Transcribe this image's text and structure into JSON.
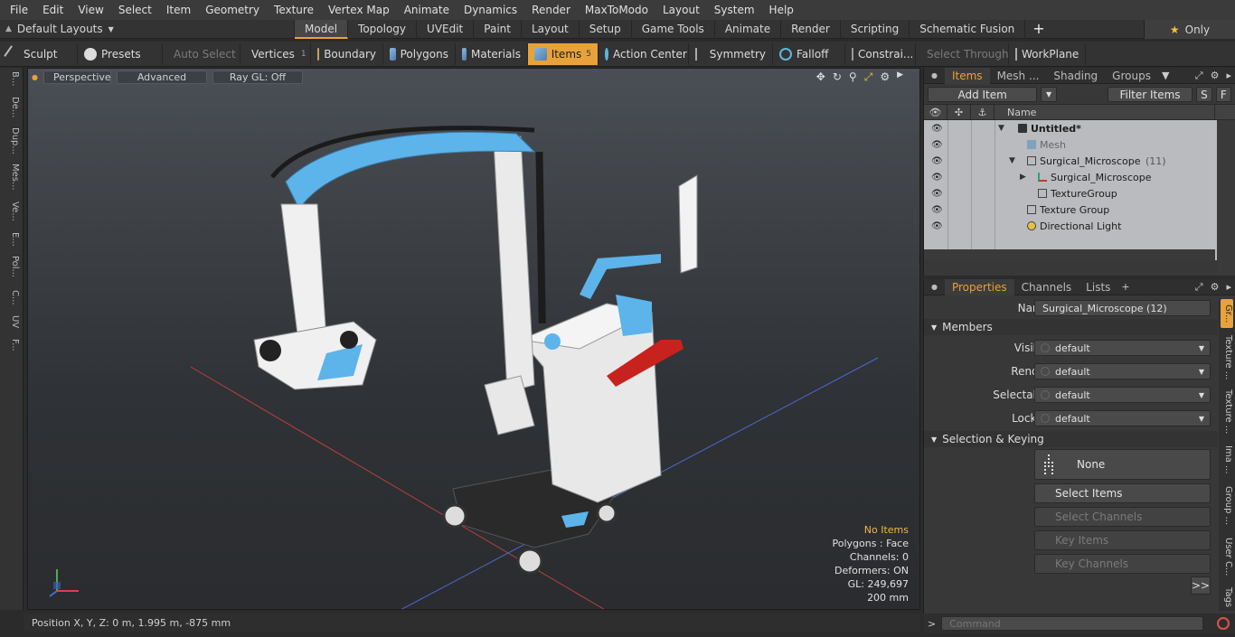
{
  "menu": [
    "File",
    "Edit",
    "View",
    "Select",
    "Item",
    "Geometry",
    "Texture",
    "Vertex Map",
    "Animate",
    "Dynamics",
    "Render",
    "MaxToModo",
    "Layout",
    "System",
    "Help"
  ],
  "layout_bar": {
    "layout_select": "Default Layouts",
    "tabs": [
      "Model",
      "Topology",
      "UVEdit",
      "Paint",
      "Layout",
      "Setup",
      "Game Tools",
      "Animate",
      "Render",
      "Scripting",
      "Schematic Fusion"
    ],
    "active_tab": "Model",
    "only_label": "Only"
  },
  "toolbar": {
    "sculpt": "Sculpt",
    "presets": "Presets",
    "auto_select": "Auto Select",
    "vertices": "Vertices",
    "vertices_count": "1",
    "boundary": "Boundary",
    "polygons": "Polygons",
    "materials": "Materials",
    "items": "Items",
    "items_count": "5",
    "action_center": "Action Center",
    "symmetry": "Symmetry",
    "falloff": "Falloff",
    "constraints": "Constrai...",
    "select_through": "Select Through",
    "workplane": "WorkPlane"
  },
  "left_tabs": [
    "B...",
    "De...",
    "Dup...",
    "Mes...",
    "Ve...",
    "E...",
    "Pol...",
    "C...",
    "UV",
    "F..."
  ],
  "viewport": {
    "view_mode": "Perspective",
    "shading": "Advanced",
    "raygl": "Ray GL: Off",
    "info": {
      "selection": "No Items",
      "polygons": "Polygons : Face",
      "channels": "Channels: 0",
      "deformers": "Deformers: ON",
      "gl": "GL: 249,697",
      "scale": "200 mm"
    }
  },
  "status": {
    "position": "Position X, Y, Z:   0 m, 1.995 m, -875 mm"
  },
  "items_panel": {
    "tabs": [
      "Items",
      "Mesh ...",
      "Shading",
      "Groups"
    ],
    "active_tab": "Items",
    "add_item": "Add Item",
    "filter_items": "Filter Items",
    "s_btn": "S",
    "f_btn": "F",
    "name_col": "Name",
    "tree": [
      {
        "label": "Untitled*",
        "count": ""
      },
      {
        "label": "Mesh",
        "count": ""
      },
      {
        "label": "Surgical_Microscope",
        "count": "(11)"
      },
      {
        "label": "Surgical_Microscope",
        "count": ""
      },
      {
        "label": "TextureGroup",
        "count": ""
      },
      {
        "label": "Texture Group",
        "count": ""
      },
      {
        "label": "Directional Light",
        "count": ""
      }
    ]
  },
  "properties_panel": {
    "tabs": [
      "Properties",
      "Channels",
      "Lists"
    ],
    "active_tab": "Properties",
    "name_label": "Name",
    "name_value": "Surgical_Microscope (12)",
    "members_section": "Members",
    "visible_label": "Visible",
    "visible_value": "default",
    "render_label": "Render",
    "render_value": "default",
    "selectable_label": "Selectable",
    "selectable_value": "default",
    "locked_label": "Locked",
    "locked_value": "default",
    "selection_section": "Selection & Keying",
    "none_label": "None",
    "select_items": "Select Items",
    "select_channels": "Select Channels",
    "key_items": "Key Items",
    "key_channels": "Key Channels",
    "expand": ">>",
    "side_tabs": [
      "Gr...",
      "Texture ...",
      "Texture ...",
      "Ima ...",
      "Group ...",
      "User C...",
      "Tags"
    ]
  },
  "command": {
    "prompt": ">",
    "placeholder": "Command"
  },
  "colors": {
    "accent": "#e8a23a",
    "model_blue": "#5db4ea",
    "model_red": "#c8221e"
  }
}
